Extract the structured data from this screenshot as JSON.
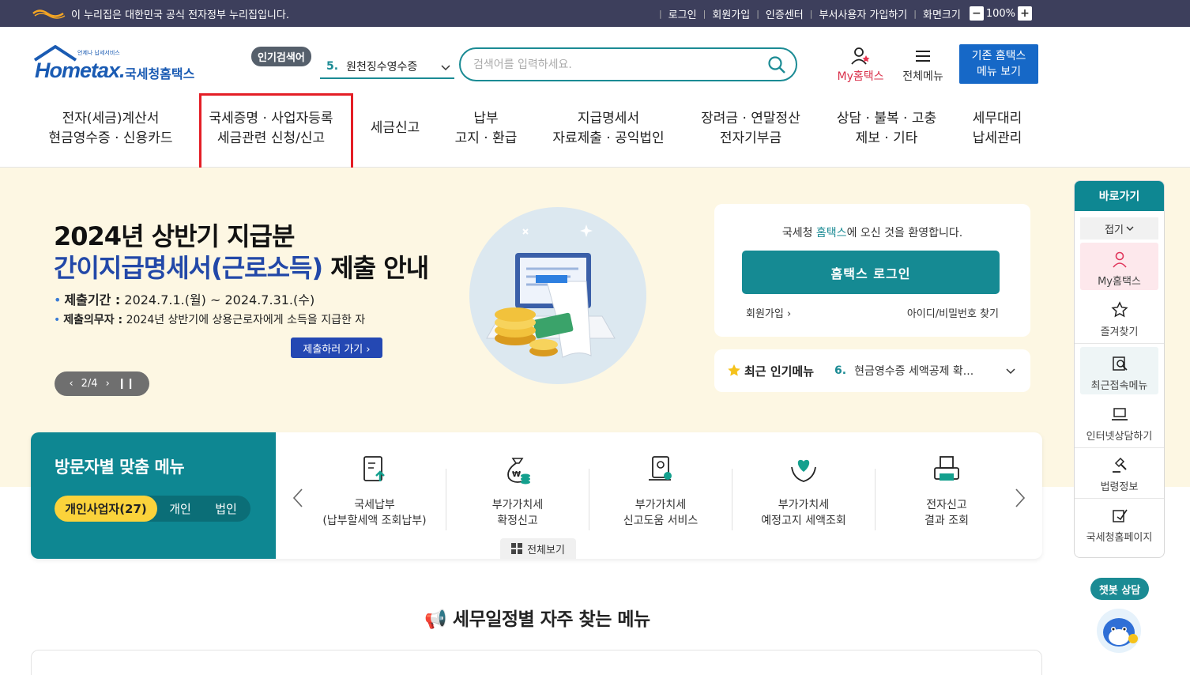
{
  "gov_bar": {
    "notice": "이 누리집은 대한민국 공식 전자정부 누리집입니다.",
    "links": [
      "로그인",
      "회원가입",
      "인증센터",
      "부서사용자 가입하기",
      "화면크기"
    ],
    "zoom": "100%",
    "zoom_minus": "−",
    "zoom_plus": "+"
  },
  "header": {
    "logo_text": "Hometax.",
    "logo_sub": "국세청홈택스",
    "logo_tiny": "언제나 납세서비스",
    "popular_badge": "인기검색어",
    "popular_num": "5.",
    "popular_text": "원천징수영수증",
    "search_placeholder": "검색어를 입력하세요.",
    "my_label_en": "My",
    "my_label_ko": "홈택스",
    "all_menu": "전체메뉴",
    "old_menu_line1": "기존 홈택스",
    "old_menu_line2": "메뉴 보기"
  },
  "gnb": [
    {
      "l1": "전자(세금)계산서",
      "l2": "현금영수증 · 신용카드"
    },
    {
      "l1": "국세증명 · 사업자등록",
      "l2": "세금관련 신청/신고"
    },
    {
      "l1": "세금신고",
      "l2": ""
    },
    {
      "l1": "납부",
      "l2": "고지 · 환급"
    },
    {
      "l1": "지급명세서",
      "l2": "자료제출 · 공익법인"
    },
    {
      "l1": "장려금 · 연말정산",
      "l2": "전자기부금"
    },
    {
      "l1": "상담 · 불복 · 고충",
      "l2": "제보 · 기타"
    },
    {
      "l1": "세무대리",
      "l2": "납세관리"
    }
  ],
  "hero": {
    "title1": "2024년 상반기 지급분",
    "title2_blue": "간이지급명세서(근로소득)",
    "title2_rest": " 제출 안내",
    "line1_label": "제출기간 :",
    "line1_value": " 2024.7.1.(월) ~ 2024.7.31.(수)",
    "line2_label": "제출의무자 :",
    "line2_value": " 2024년 상반기에 상용근로자에게 소득을 지급한 자",
    "cta": "제출하러 가기 ›",
    "pager": "2/4"
  },
  "login": {
    "welcome_pre": "국세청 ",
    "welcome_teal": "홈택스",
    "welcome_post": "에 오신 것을 환영합니다.",
    "button": "홈택스 로그인",
    "join": "회원가입 ›",
    "find": "아이디/비밀번호 찾기"
  },
  "recent": {
    "label": "최근 인기메뉴",
    "num": "6.",
    "text": "현금영수증 세액공제 확..."
  },
  "visitor": {
    "title": "방문자별 맞춤 메뉴",
    "tabs": [
      "개인사업자(27)",
      "개인",
      "법인"
    ],
    "items": [
      {
        "l1": "국세납부",
        "l2": "(납부할세액 조회납부)",
        "icon": "document-upload-icon"
      },
      {
        "l1": "부가가치세",
        "l2": "확정신고",
        "icon": "money-bag-icon"
      },
      {
        "l1": "부가가치세",
        "l2": "신고도움 서비스",
        "icon": "help-document-icon"
      },
      {
        "l1": "부가가치세",
        "l2": "예정고지 세액조회",
        "icon": "heart-hands-icon"
      },
      {
        "l1": "전자신고",
        "l2": "결과 조회",
        "icon": "printer-icon"
      }
    ],
    "all_view": "전체보기"
  },
  "schedule": {
    "title": "세무일정별 자주 찾는 메뉴"
  },
  "quick": {
    "title": "바로가기",
    "fold": "접기",
    "items": [
      "My홈택스",
      "즐겨찾기",
      "최근접속메뉴",
      "인터넷상담하기",
      "법령정보",
      "국세청홈페이지"
    ]
  },
  "chatbot": {
    "label": "챗봇 상담"
  },
  "colors": {
    "teal": "#0e8792",
    "navy_bar": "#3d3f5c",
    "highlight_red": "#e41e26",
    "hero_bg": "#fdf7e3",
    "blue": "#1668c7"
  }
}
